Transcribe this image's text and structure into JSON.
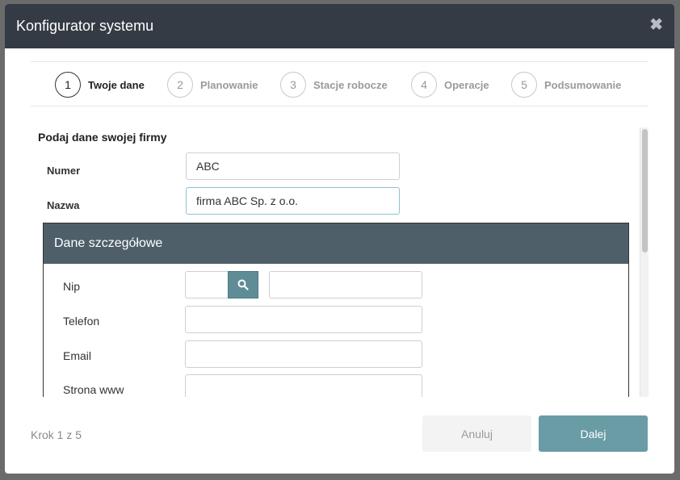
{
  "dialog": {
    "title": "Konfigurator systemu"
  },
  "steps": [
    {
      "number": "1",
      "label": "Twoje dane",
      "active": true
    },
    {
      "number": "2",
      "label": "Planowanie",
      "active": false
    },
    {
      "number": "3",
      "label": "Stacje robocze",
      "active": false
    },
    {
      "number": "4",
      "label": "Operacje",
      "active": false
    },
    {
      "number": "5",
      "label": "Podsumowanie",
      "active": false
    }
  ],
  "company": {
    "section_title": "Podaj dane swojej firmy",
    "number_label": "Numer",
    "number_value": "ABC",
    "name_label": "Nazwa",
    "name_value": "firma ABC Sp. z o.o."
  },
  "details": {
    "title": "Dane szczegółowe",
    "nip_label": "Nip",
    "nip_value": "",
    "nip_extra_value": "",
    "phone_label": "Telefon",
    "phone_value": "",
    "email_label": "Email",
    "email_value": "",
    "www_label": "Strona www",
    "www_value": ""
  },
  "footer": {
    "step_text": "Krok 1 z 5",
    "cancel_label": "Anuluj",
    "next_label": "Dalej"
  },
  "colors": {
    "header_bg": "#343b45",
    "panel_header_bg": "#4f5f6a",
    "accent": "#6a9ca6"
  }
}
